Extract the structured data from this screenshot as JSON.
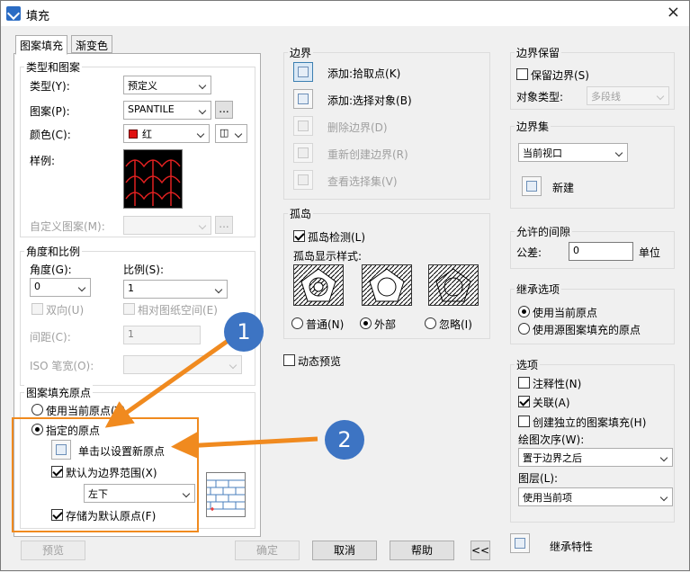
{
  "window": {
    "title": "填充",
    "close": "×"
  },
  "tabs": [
    "图案填充",
    "渐变色"
  ],
  "type_pattern": {
    "title": "类型和图案",
    "type_label": "类型(Y):",
    "type_value": "预定义",
    "pattern_label": "图案(P):",
    "pattern_value": "SPANTILE",
    "pattern_browse": "...",
    "color_label": "颜色(C):",
    "color_value": "红",
    "color_swatch": "#e01010",
    "sample_label": "样例:",
    "custom_label": "自定义图案(M):",
    "custom_browse": "..."
  },
  "angle_scale": {
    "title": "角度和比例",
    "angle_label": "角度(G):",
    "angle_value": "0",
    "scale_label": "比例(S):",
    "scale_value": "1",
    "double_label": "双向(U)",
    "relative_label": "相对图纸空间(E)",
    "spacing_label": "间距(C):",
    "spacing_value": "1",
    "iso_label": "ISO 笔宽(O):"
  },
  "origin": {
    "title": "图案填充原点",
    "use_current": "使用当前原点(T)",
    "specified": "指定的原点",
    "click_set": "单击以设置新原点",
    "default_extent": "默认为边界范围(X)",
    "extent_value": "左下",
    "store_default": "存储为默认原点(F)"
  },
  "boundary": {
    "title": "边界",
    "add_pick": "添加:拾取点(K)",
    "add_select": "添加:选择对象(B)",
    "remove": "删除边界(D)",
    "recreate": "重新创建边界(R)",
    "view": "查看选择集(V)"
  },
  "islands": {
    "title": "孤岛",
    "detect": "孤岛检测(L)",
    "style_label": "孤岛显示样式:",
    "normal": "普通(N)",
    "outer": "外部",
    "ignore": "忽略(I)"
  },
  "dynamic_preview": "动态预览",
  "retain": {
    "title": "边界保留",
    "keep": "保留边界(S)",
    "type_label": "对象类型:",
    "type_value": "多段线"
  },
  "boundary_set": {
    "title": "边界集",
    "value": "当前视口",
    "new": "新建"
  },
  "gap": {
    "title": "允许的间隙",
    "tol_label": "公差:",
    "tol_value": "0",
    "unit": "单位"
  },
  "inherit": {
    "title": "继承选项",
    "use_current": "使用当前原点",
    "use_source": "使用源图案填充的原点"
  },
  "options": {
    "title": "选项",
    "annotative": "注释性(N)",
    "associative": "关联(A)",
    "separate": "创建独立的图案填充(H)",
    "order_label": "绘图次序(W):",
    "order_value": "置于边界之后",
    "layer_label": "图层(L):",
    "layer_value": "使用当前项"
  },
  "inherit_props": "继承特性",
  "buttons": {
    "preview": "预览",
    "ok": "确定",
    "cancel": "取消",
    "help": "帮助",
    "more": "<<"
  },
  "callouts": [
    "1",
    "2"
  ],
  "colors": {
    "callout_arrow": "#f08a1f",
    "callout_badge": "#3d74c3"
  }
}
